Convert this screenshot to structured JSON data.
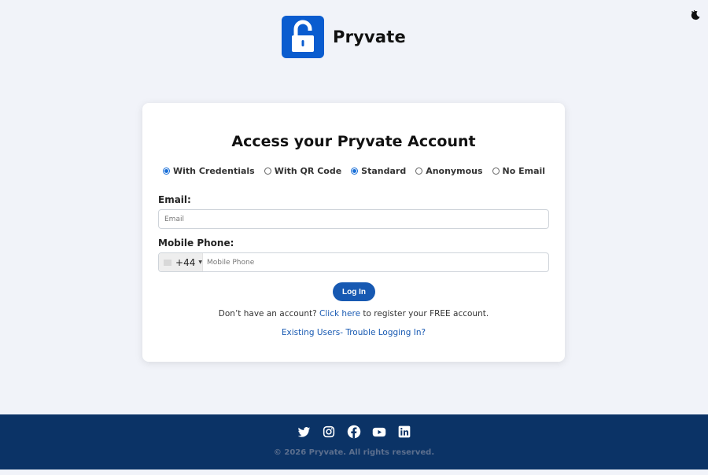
{
  "brand": {
    "name": "Pryvate",
    "logo_icon": "padlock-open-icon",
    "logo_color": "#0a5ccf"
  },
  "theme_toggle_icon": "moon-icon",
  "card": {
    "title": "Access your Pryvate Account",
    "radios": [
      {
        "label": "With Credentials",
        "checked": true
      },
      {
        "label": "With QR Code",
        "checked": false
      },
      {
        "label": "Standard",
        "checked": true
      },
      {
        "label": "Anonymous",
        "checked": false
      },
      {
        "label": "No Email",
        "checked": false
      }
    ],
    "email": {
      "label": "Email:",
      "placeholder": "Email"
    },
    "phone": {
      "label": "Mobile Phone:",
      "country_code": "+44",
      "placeholder": "Mobile Phone"
    },
    "login_button": "Log In",
    "signup": {
      "prefix": "Don’t have an account?",
      "link": "Click here",
      "suffix": "to register your FREE account."
    },
    "trouble_link": "Existing Users- Trouble Logging In?"
  },
  "footer": {
    "social_icons": [
      "twitter-icon",
      "instagram-icon",
      "facebook-icon",
      "youtube-icon",
      "linkedin-icon"
    ],
    "copyright": "© 2026 Pryvate. All rights reserved.",
    "background": "#0b3366"
  },
  "colors": {
    "accent": "#1759b2",
    "radio": "#1a6fd8",
    "page_bg": "#f1f3f9"
  }
}
